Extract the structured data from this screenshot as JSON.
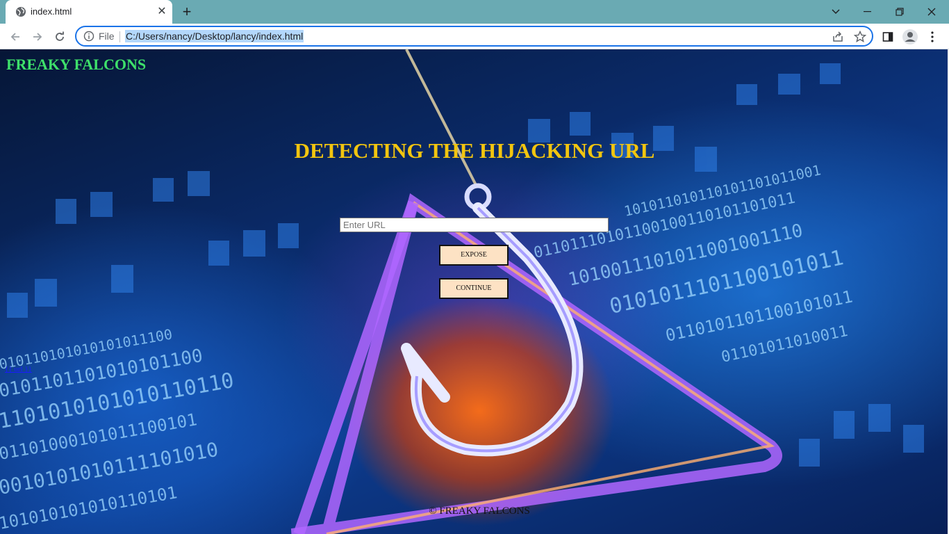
{
  "browser": {
    "tab_title": "index.html",
    "file_label": "File",
    "url": "C:/Users/nancy/Desktop/lancy/index.html",
    "colors": {
      "tabstrip": "#6aaab3",
      "omnibox_focus": "#1a73e8",
      "url_selection": "#b3d7fb"
    }
  },
  "page": {
    "brand": "FREAKY FALCONS",
    "headline": "DETECTING THE HIJACKING URL",
    "url_input_placeholder": "Enter URL",
    "expose_button": "EXPOSE",
    "continue_button": "CONTINUE",
    "side_link": "{{ url }}",
    "footer": "© FREAKY FALCONS",
    "colors": {
      "brand": "#3ee06a",
      "headline": "#f2c50f",
      "button_bg": "#fde2c4"
    }
  }
}
